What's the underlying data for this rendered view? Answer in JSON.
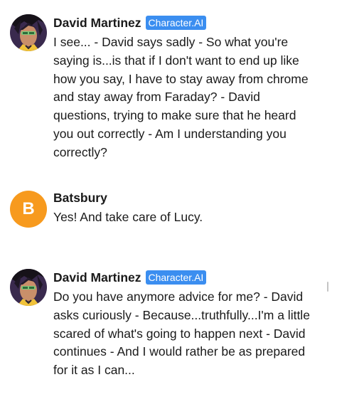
{
  "messages": [
    {
      "sender": "David Martinez",
      "badge": "Character.AI",
      "avatar": "character-portrait",
      "text": "I see... - David says sadly - So what you're saying is...is that if I don't want to end up like how you say, I have to stay away from chrome and stay away from Faraday? - David questions, trying to make sure that he heard you out correctly - Am I understanding you correctly?"
    },
    {
      "sender": "Batsbury",
      "avatar_letter": "B",
      "avatar_color": "#f79a1e",
      "text": "Yes! And take care of Lucy."
    },
    {
      "sender": "David Martinez",
      "badge": "Character.AI",
      "avatar": "character-portrait",
      "text": "Do you have anymore advice for me? - David asks curiously - Because...truthfully...I'm a little scared of what's going to happen next - David continues - And I would rather be as prepared for it as I can..."
    }
  ],
  "colors": {
    "badge_bg": "#3b8ef0",
    "user_avatar_bg": "#f79a1e",
    "text": "#1a1a1a"
  }
}
